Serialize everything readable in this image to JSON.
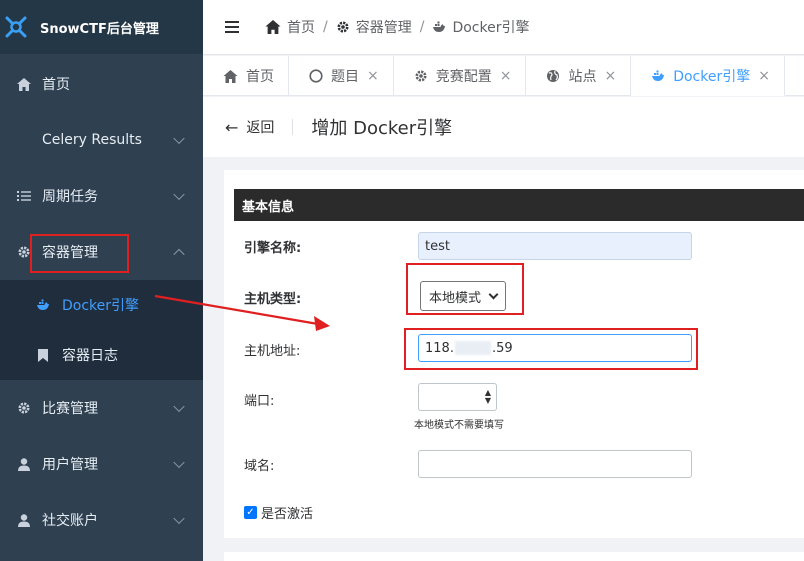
{
  "app": {
    "title": "SnowCTF后台管理"
  },
  "sidebar": {
    "items": [
      {
        "label": "首页",
        "icon": "home-icon"
      },
      {
        "label": "Celery Results"
      },
      {
        "label": "周期任务",
        "icon": "tasks-icon"
      },
      {
        "label": "容器管理",
        "icon": "gear-icon",
        "expanded": true
      },
      {
        "label": "比赛管理",
        "icon": "gear-icon"
      },
      {
        "label": "用户管理",
        "icon": "user-icon"
      },
      {
        "label": "社交账户",
        "icon": "user-icon"
      }
    ],
    "subitems": [
      {
        "label": "Docker引擎",
        "icon": "docker-icon",
        "active": true
      },
      {
        "label": "容器日志",
        "icon": "bookmark-icon"
      }
    ]
  },
  "breadcrumb": {
    "home": "首页",
    "section": "容器管理",
    "current": "Docker引擎",
    "separator": "/"
  },
  "tabs": [
    {
      "label": "首页",
      "icon": "home-icon",
      "closable": false
    },
    {
      "label": "题目",
      "icon": "circle-icon",
      "closable": true
    },
    {
      "label": "竞赛配置",
      "icon": "gear-icon",
      "closable": true
    },
    {
      "label": "站点",
      "icon": "globe-icon",
      "closable": true
    },
    {
      "label": "Docker引擎",
      "icon": "docker-icon",
      "closable": true,
      "active": true
    }
  ],
  "tab_close": "×",
  "titlebar": {
    "back_label": "返回",
    "title": "增加 Docker引擎"
  },
  "form": {
    "section": "基本信息",
    "engine_name": {
      "label": "引擎名称:",
      "value": "test"
    },
    "host_type": {
      "label": "主机类型:",
      "value": "本地模式"
    },
    "host_addr": {
      "label": "主机地址:",
      "value_prefix": "118.",
      "value_suffix": ".59"
    },
    "port": {
      "label": "端口:",
      "hint": "本地模式不需要填写"
    },
    "domain": {
      "label": "域名:",
      "value": ""
    },
    "active": {
      "label": "是否激活",
      "checked": true
    }
  },
  "colors": {
    "sidebar": "#2f4050",
    "accent": "#409eff",
    "annotation": "#e02020"
  }
}
